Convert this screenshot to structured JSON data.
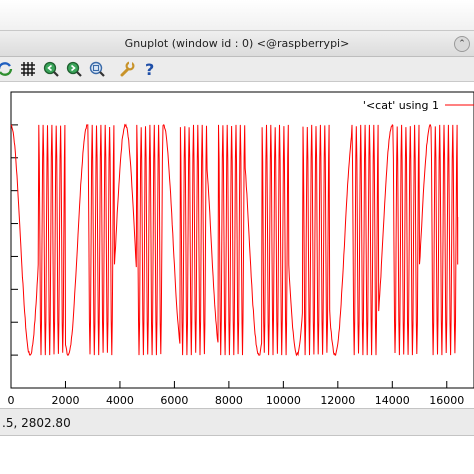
{
  "window": {
    "title": "Gnuplot (window id : 0) <@raspberrypi>",
    "close_glyph": "⌃"
  },
  "toolbar": {
    "items": [
      {
        "icon": "replot-icon"
      },
      {
        "icon": "grid-icon"
      },
      {
        "icon": "zoom-previous-icon"
      },
      {
        "icon": "zoom-next-icon"
      },
      {
        "icon": "autoscale-icon"
      },
      {
        "icon": "settings-wrench-icon"
      },
      {
        "icon": "help-icon",
        "label": "?"
      }
    ]
  },
  "status": {
    "text": ".5,  2802.80"
  },
  "chart_data": {
    "type": "line",
    "title": "",
    "xlabel": "",
    "ylabel": "",
    "xlim": [
      0,
      17000
    ],
    "ylim": [
      0,
      9
    ],
    "x_ticks": [
      0,
      2000,
      4000,
      6000,
      8000,
      10000,
      12000,
      14000,
      16000
    ],
    "x_tick_labels": [
      "0",
      "2000",
      "4000",
      "6000",
      "8000",
      "10000",
      "12000",
      "14000",
      "16000"
    ],
    "y_ticks": [
      0,
      1,
      2,
      3,
      4,
      5,
      6,
      7,
      8,
      9
    ],
    "grid": false,
    "legend": "top-right",
    "series": [
      {
        "name": "'<cat' using 1",
        "color": "#ff0000",
        "x_start": 0,
        "x_end": 16400,
        "oscillation_min": 1.0,
        "oscillation_max": 8.0,
        "end_value": 5.2,
        "burst_centers": [
          1500,
          3300,
          5100,
          6700,
          8100,
          9700,
          11200,
          13000,
          14500,
          15900
        ],
        "burst_half_width": 480,
        "cycles_per_burst": 6
      }
    ]
  }
}
